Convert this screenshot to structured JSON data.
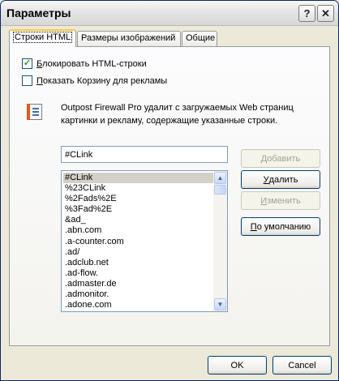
{
  "window": {
    "title": "Параметры",
    "help_icon": "?",
    "close_icon": "✕"
  },
  "tabs": [
    {
      "label": "Строки HTML",
      "active": true
    },
    {
      "label": "Размеры изображений",
      "active": false
    },
    {
      "label": "Общие",
      "active": false
    }
  ],
  "options": {
    "block_html": {
      "label_hotkey": "Б",
      "label_rest": "локировать HTML-строки",
      "checked": true,
      "check_mark": "✓"
    },
    "show_bin": {
      "label_hotkey": "П",
      "label_rest": "оказать Корзину для рекламы",
      "checked": false
    }
  },
  "description": "Outpost Firewall Pro удалит с загружаемых Web страниц картинки и рекламу, содержащие указанные строки.",
  "input": {
    "value": "#CLink"
  },
  "list": {
    "items": [
      "#CLink",
      "%23CLink",
      "%2Fads%2E",
      "%3Fad%2E",
      "&ad_",
      ".abn.com",
      ".a-counter.com",
      ".ad/",
      ".adclub.net",
      ".ad-flow.",
      ".admaster.de",
      ".admonitor.",
      ".adone.com"
    ],
    "selected_index": 0,
    "scroll_up": "▲",
    "scroll_down": "▼"
  },
  "buttons": {
    "add": {
      "hotkey": "Д",
      "rest": "обавить",
      "enabled": false
    },
    "delete": {
      "hotkey": "У",
      "rest": "далить",
      "enabled": true
    },
    "edit": {
      "hotkey": "И",
      "rest": "зменить",
      "enabled": false
    },
    "default": {
      "hotkey": "П",
      "rest": "о умолчанию",
      "enabled": true
    },
    "ok": "OK",
    "cancel": "Cancel"
  },
  "colors": {
    "titlebar": "#e6e6e6",
    "dialog_bg": "#ece9d8",
    "active_tab_accent": "#ffc83c",
    "selected_item": "#d4d0c8",
    "checkmark": "#21a121"
  }
}
